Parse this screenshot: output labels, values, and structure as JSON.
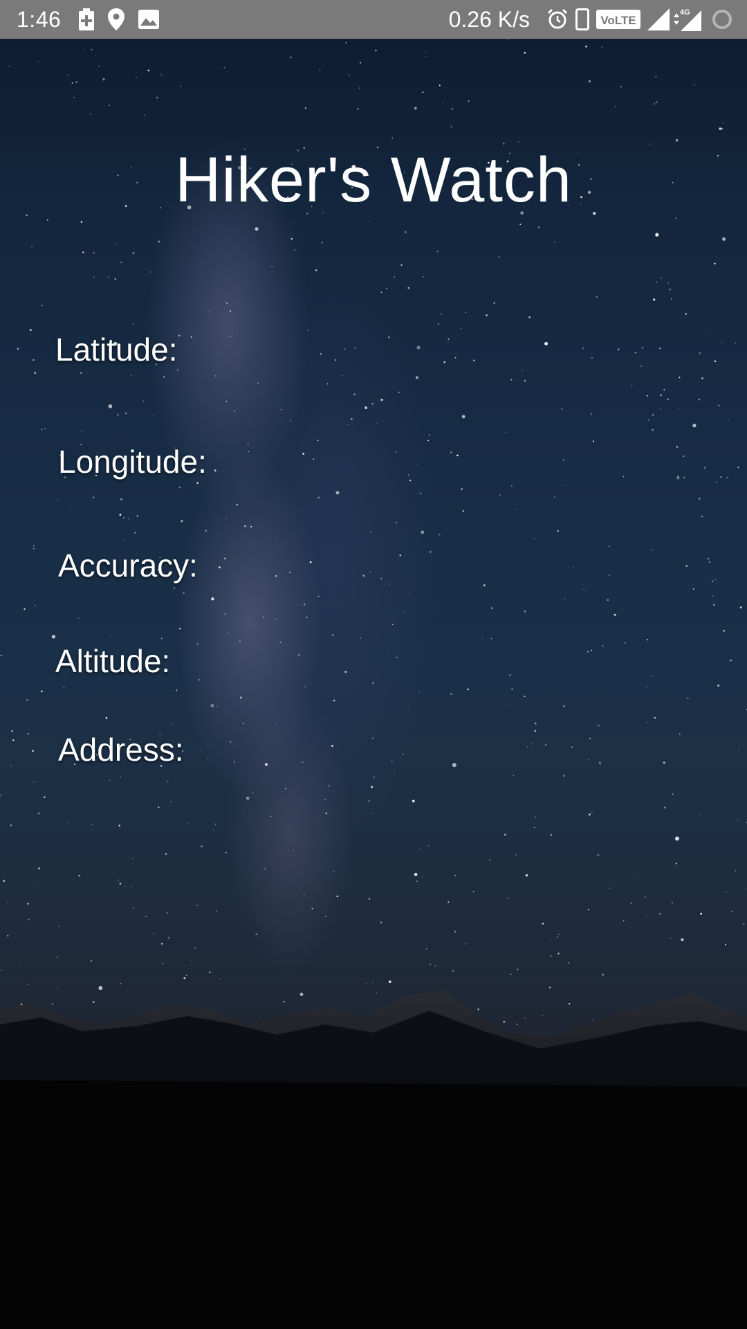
{
  "status_bar": {
    "time": "1:46",
    "left_icons": [
      "battery-charging-icon",
      "location-pin-icon",
      "image-icon"
    ],
    "net_speed": "0.26 K/s",
    "right_icons": [
      "alarm-icon",
      "phone-icon",
      "volte-icon",
      "signal-icon",
      "signal-4g-icon",
      "sync-loading-icon"
    ],
    "volte_label": "VoLTE",
    "network_type": "4G"
  },
  "app": {
    "title": "Hiker's Watch",
    "fields": {
      "latitude": "Latitude:",
      "longitude": "Longitude:",
      "accuracy": "Accuracy:",
      "altitude": "Altitude:",
      "address": "Address:"
    }
  },
  "colors": {
    "status_bar_bg": "#7a7a7a",
    "text": "#ffffff",
    "sky": "#172c45"
  }
}
